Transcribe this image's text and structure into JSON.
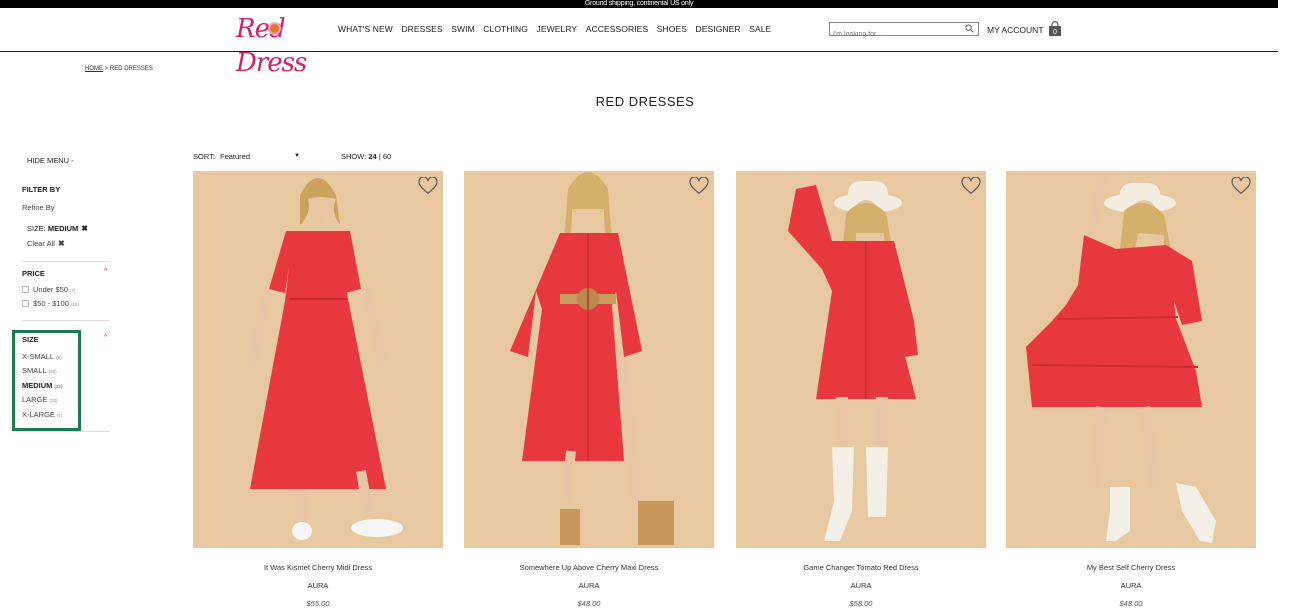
{
  "promo": "Ground shipping, continental US only",
  "header": {
    "logo_text": "Red Dress",
    "nav": [
      "WHAT'S NEW",
      "DRESSES",
      "SWIM",
      "CLOTHING",
      "JEWELRY",
      "ACCESSORIES",
      "SHOES",
      "DESIGNER",
      "SALE"
    ],
    "search_placeholder": "I'm looking for...",
    "account_label": "MY ACCOUNT",
    "bag_count": "0"
  },
  "breadcrumb": {
    "home": "HOME",
    "sep": ">",
    "current": "RED DRESSES"
  },
  "page_title": "RED DRESSES",
  "sidebar": {
    "hide_menu": "HIDE MENU -",
    "filter_by": "FILTER BY",
    "refine_by": "Refine By",
    "active_filter": {
      "label": "SIZE:",
      "value": "MEDIUM"
    },
    "clear_all": "Clear All",
    "price": {
      "title": "PRICE",
      "options": [
        {
          "label": "Under $50",
          "count": "(7)"
        },
        {
          "label": "$50 - $100",
          "count": "(15)"
        }
      ]
    },
    "size": {
      "title": "SIZE",
      "options": [
        {
          "label": "X-SMALL",
          "count": "(5)"
        },
        {
          "label": "SMALL",
          "count": "(20)"
        },
        {
          "label": "MEDIUM",
          "count": "(22)"
        },
        {
          "label": "LARGE",
          "count": "(20)"
        },
        {
          "label": "X-LARGE",
          "count": "(7)"
        }
      ]
    }
  },
  "toolbar": {
    "sort_label": "SORT:",
    "sort_value": "Featured",
    "show_label": "SHOW:",
    "show_24": "24",
    "show_sep": "|",
    "show_60": "60"
  },
  "products": [
    {
      "name": "It Was Kismet Cherry Midi Dress",
      "brand": "AURA",
      "price": "$55.00"
    },
    {
      "name": "Somewhere Up Above Cherry Maxi Dress",
      "brand": "AURA",
      "price": "$48.00"
    },
    {
      "name": "Game Changer Tomato Red Dress",
      "brand": "AURA",
      "price": "$58.00"
    },
    {
      "name": "My Best Self Cherry Dress",
      "brand": "AURA",
      "price": "$48.00"
    }
  ],
  "colors": {
    "brand_pink": "#d0246a",
    "dress_red": "#e8383f",
    "backdrop": "#e8c8a0",
    "highlight_box": "#1a7a55"
  }
}
